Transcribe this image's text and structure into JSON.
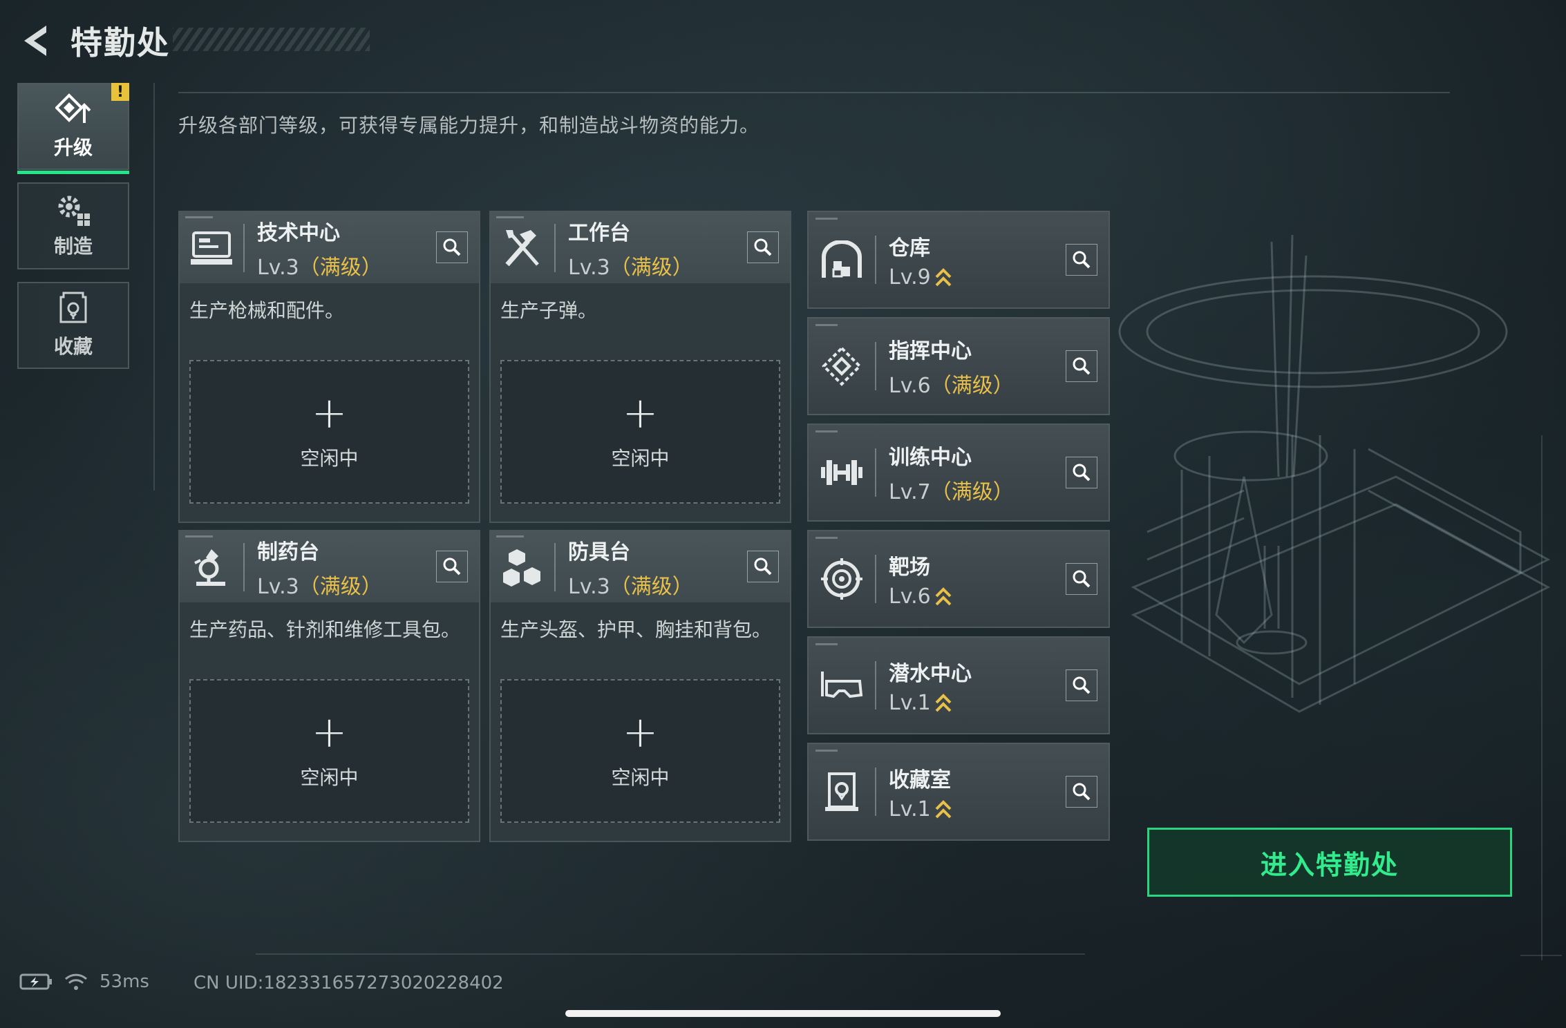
{
  "header": {
    "title": "特勤处"
  },
  "nav": {
    "items": [
      {
        "label": "升级",
        "icon": "upgrade-icon",
        "active": true,
        "badge": "!"
      },
      {
        "label": "制造",
        "icon": "gears-icon",
        "active": false
      },
      {
        "label": "收藏",
        "icon": "trophy-case-icon",
        "active": false
      }
    ]
  },
  "main": {
    "subtitle": "升级各部门等级，可获得专属能力提升，和制造战斗物资的能力。",
    "production": [
      {
        "name": "技术中心",
        "level": "Lv.3",
        "max": "（满级）",
        "desc": "生产枪械和配件。",
        "slot_plus": "+",
        "slot_label": "空闲中",
        "icon": "computer-icon"
      },
      {
        "name": "工作台",
        "level": "Lv.3",
        "max": "（满级）",
        "desc": "生产子弹。",
        "slot_plus": "+",
        "slot_label": "空闲中",
        "icon": "tools-icon"
      },
      {
        "name": "制药台",
        "level": "Lv.3",
        "max": "（满级）",
        "desc": "生产药品、针剂和维修工具包。",
        "slot_plus": "+",
        "slot_label": "空闲中",
        "icon": "microscope-icon"
      },
      {
        "name": "防具台",
        "level": "Lv.3",
        "max": "（满级）",
        "desc": "生产头盔、护甲、胸挂和背包。",
        "slot_plus": "+",
        "slot_label": "空闲中",
        "icon": "boxes-icon"
      }
    ],
    "departments": [
      {
        "name": "仓库",
        "level": "Lv.9",
        "max": "",
        "upgradable": true,
        "icon": "warehouse-icon"
      },
      {
        "name": "指挥中心",
        "level": "Lv.6",
        "max": "（满级）",
        "upgradable": false,
        "icon": "command-icon"
      },
      {
        "name": "训练中心",
        "level": "Lv.7",
        "max": "（满级）",
        "upgradable": false,
        "icon": "dumbbell-icon"
      },
      {
        "name": "靶场",
        "level": "Lv.6",
        "max": "",
        "upgradable": true,
        "icon": "target-icon"
      },
      {
        "name": "潜水中心",
        "level": "Lv.1",
        "max": "",
        "upgradable": true,
        "icon": "diving-mask-icon"
      },
      {
        "name": "收藏室",
        "level": "Lv.1",
        "max": "",
        "upgradable": true,
        "icon": "display-case-icon"
      }
    ]
  },
  "enter_button": {
    "label": "进入特勤处"
  },
  "status": {
    "ping": "53ms",
    "uid": "CN UID:182331657273020228402"
  },
  "colors": {
    "accent": "#31ec8c",
    "max_level": "#e9c14a",
    "badge": "#e8c33a"
  }
}
